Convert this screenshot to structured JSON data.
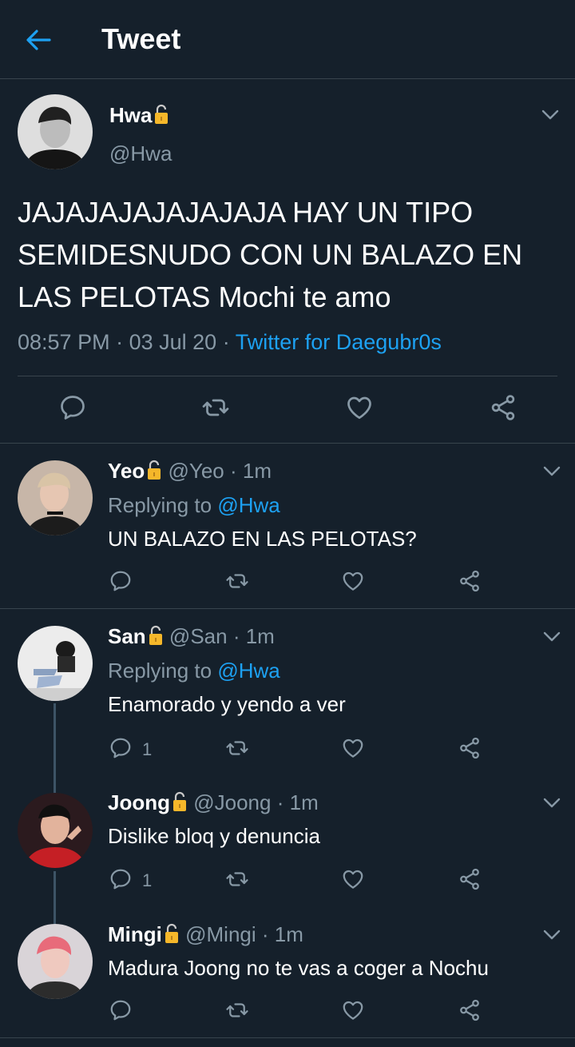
{
  "header": {
    "title": "Tweet"
  },
  "colors": {
    "background": "#15202b",
    "accent": "#1da1f2",
    "muted": "#8899a6",
    "divider": "#38444d",
    "lock": "#f5b72a"
  },
  "main_tweet": {
    "name": "Hwa",
    "handle": "@Hwa",
    "text": "JAJAJAJAJAJAJAJA HAY UN TIPO SEMIDESNUDO CON UN BALAZO EN LAS PELOTAS Mochi te amo",
    "time": "08:57 PM",
    "date": "03 Jul 20",
    "source": "Twitter for Daegubr0s",
    "sep": "·"
  },
  "replies": [
    {
      "name": "Yeo",
      "handle": "@Yeo",
      "time": "1m",
      "replying_label": "Replying to",
      "replying_to": "@Hwa",
      "text": "UN BALAZO EN LAS PELOTAS?",
      "reply_count": ""
    },
    {
      "name": "San",
      "handle": "@San",
      "time": "1m",
      "replying_label": "Replying to",
      "replying_to": "@Hwa",
      "text": "Enamorado y yendo a ver",
      "reply_count": "1"
    },
    {
      "name": "Joong",
      "handle": "@Joong",
      "time": "1m",
      "text": "Dislike bloq y denuncia",
      "reply_count": "1"
    },
    {
      "name": "Mingi",
      "handle": "@Mingi",
      "time": "1m",
      "text": "Madura Joong no te vas a coger a Nochu",
      "reply_count": ""
    }
  ],
  "icons": [
    "back-arrow-icon",
    "lock-icon",
    "chevron-down-icon",
    "reply-icon",
    "retweet-icon",
    "like-icon",
    "share-icon"
  ]
}
